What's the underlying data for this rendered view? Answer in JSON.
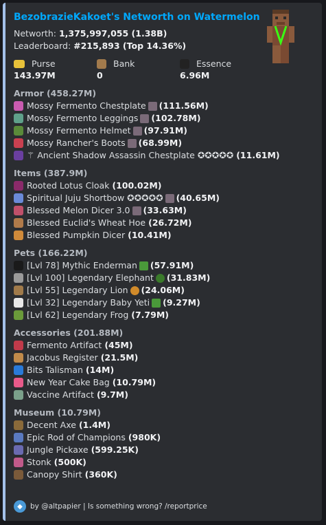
{
  "header": {
    "title": "BezobrazieKakoet's Networth on Watermelon",
    "networth_label": "Networth: ",
    "networth_value": "1,375,997,055 (1.38B)",
    "leaderboard_label": "Leaderboard: ",
    "leaderboard_value": "#215,893 (Top 14.36%)"
  },
  "stats": {
    "purse": {
      "label": "Purse",
      "value": "143.97M"
    },
    "bank": {
      "label": "Bank",
      "value": "0"
    },
    "essence": {
      "label": "Essence",
      "value": "6.96M"
    }
  },
  "armor": {
    "header": "Armor (458.27M)",
    "items": [
      {
        "name": "Mossy Fermento Chestplate",
        "value": "(111.56M)"
      },
      {
        "name": "Mossy Fermento Leggings",
        "value": "(102.78M)"
      },
      {
        "name": "Mossy Fermento Helmet",
        "value": "(97.91M)"
      },
      {
        "name": "Mossy Rancher's Boots",
        "value": "(68.99M)"
      },
      {
        "name": "Ancient Shadow Assassin Chestplate ✪✪✪✪✪",
        "value": "(11.61M)"
      }
    ]
  },
  "items": {
    "header": "Items (387.9M)",
    "items": [
      {
        "name": "Rooted Lotus Cloak",
        "value": "(100.02M)"
      },
      {
        "name": "Spiritual Juju Shortbow ✪✪✪✪✪",
        "value": "(40.65M)"
      },
      {
        "name": "Blessed Melon Dicer 3.0",
        "value": "(33.63M)"
      },
      {
        "name": "Blessed Euclid's Wheat Hoe",
        "value": "(26.72M)"
      },
      {
        "name": "Blessed Pumpkin Dicer",
        "value": "(10.41M)"
      }
    ]
  },
  "pets": {
    "header": "Pets (166.22M)",
    "items": [
      {
        "name": "[Lvl 78] Mythic Enderman",
        "value": "(57.91M)"
      },
      {
        "name": "[Lvl 100] Legendary Elephant",
        "value": "(31.83M)"
      },
      {
        "name": "[Lvl 55] Legendary Lion",
        "value": "(24.06M)"
      },
      {
        "name": "[Lvl 32] Legendary Baby Yeti",
        "value": "(9.27M)"
      },
      {
        "name": "[Lvl 62] Legendary Frog",
        "value": "(7.79M)"
      }
    ]
  },
  "accessories": {
    "header": "Accessories (201.88M)",
    "items": [
      {
        "name": "Fermento Artifact",
        "value": "(45M)"
      },
      {
        "name": "Jacobus Register",
        "value": "(21.5M)"
      },
      {
        "name": "Bits Talisman",
        "value": "(14M)"
      },
      {
        "name": "New Year Cake Bag",
        "value": "(10.79M)"
      },
      {
        "name": "Vaccine Artifact",
        "value": "(9.7M)"
      }
    ]
  },
  "museum": {
    "header": "Museum (10.79M)",
    "items": [
      {
        "name": "Decent Axe",
        "value": "(1.4M)"
      },
      {
        "name": "Epic Rod of Champions",
        "value": "(980K)"
      },
      {
        "name": "Jungle Pickaxe",
        "value": "(599.25K)"
      },
      {
        "name": "Stonk",
        "value": "(500K)"
      },
      {
        "name": "Canopy Shirt",
        "value": "(360K)"
      }
    ]
  },
  "footer": {
    "text": "by @altpapier | Is something wrong? /reportprice"
  },
  "colors": {
    "link": "#00a8fc",
    "embed_bg": "#2b2d31",
    "accent_bar": "#a3c1ea"
  }
}
